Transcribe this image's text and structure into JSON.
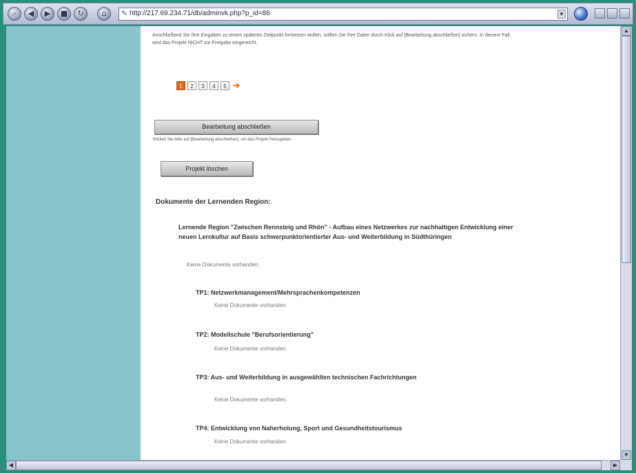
{
  "browser": {
    "url": "http://217.69.234.71/db/adminvk.php?p_id=86"
  },
  "page": {
    "notice": "Anschließend Sie Ihre Eingaben zu einem späteren Zeitpunkt fortsetzen wollen, sollten Sie Ihre Daten durch Klick auf [Bearbeitung abschließen] sichern. In diesem Fall wird das Projekt NICHT zur Freigabe eingereicht.",
    "pagination": {
      "pages": [
        "1",
        "2",
        "3",
        "4",
        "5"
      ],
      "active_index": 0,
      "next_symbol": "➔"
    },
    "finish_button": "Bearbeitung abschließen",
    "finish_hint": "Klicken Sie bitte auf [Bearbeitung abschließen], um das Projekt freizugeben.",
    "delete_button": "Projekt löschen",
    "documents_heading": "Dokumente der Lernenden Region:",
    "project_title": "Lernende Region \"Zwischen Rennsteig und Rhön\" - Aufbau eines Netzwerkes zur nachhaltigen Entwicklung einer neuen Lernkultur auf Basis schwerpunktorientierter Aus- und Weiterbildung in Südthüringen",
    "project_no_docs": "Keine Dokumente vorhanden.",
    "subprojects": [
      {
        "title": "TP1: Netzwerkmanagement/Mehrsprachenkompetenzen",
        "status": "Keine Dokumente vorhanden."
      },
      {
        "title": "TP2: Modellschule \"Berufsorientierung\"",
        "status": "Keine Dokumente vorhanden."
      },
      {
        "title": "TP3: Aus- und Weiterbildung in ausgewählten technischen Fachrichtungen",
        "status": "Keine Dokumente vorhanden."
      },
      {
        "title": "TP4: Entwicklung von Naherholung, Sport und Gesundheitstourismus",
        "status": "Keine Dokumente vorhanden."
      }
    ]
  }
}
